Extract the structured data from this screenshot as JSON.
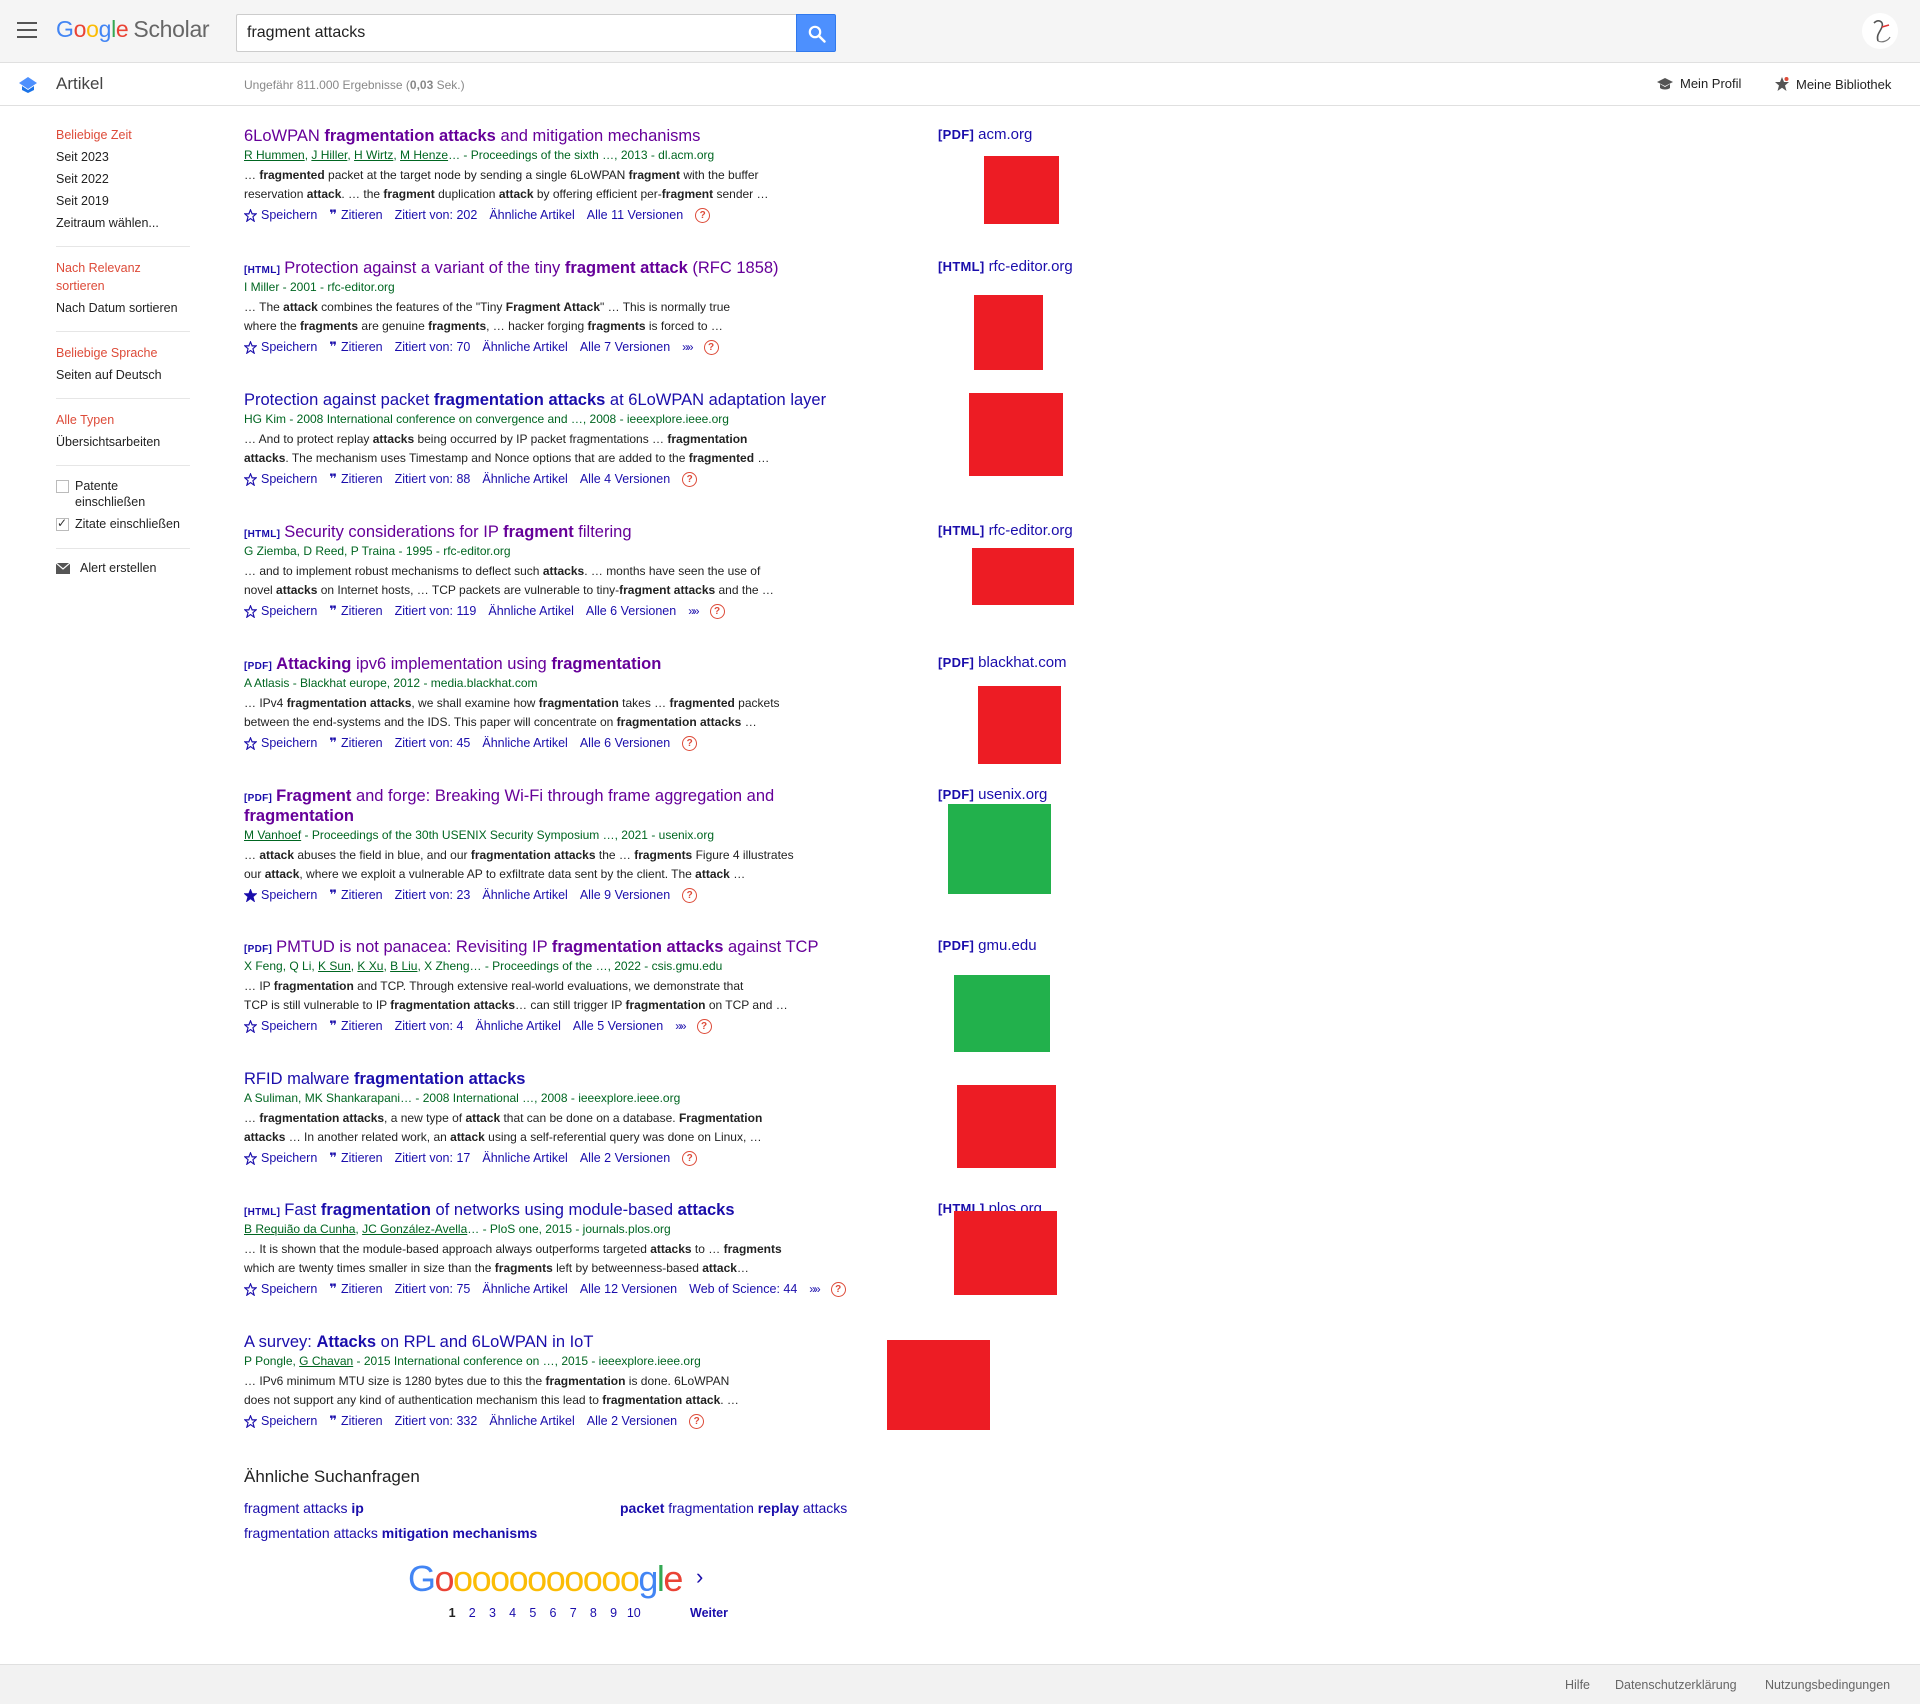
{
  "header": {
    "logo_google": [
      "G",
      "o",
      "o",
      "g",
      "l",
      "e"
    ],
    "logo_scholar": "Scholar",
    "search_value": "fragment attacks"
  },
  "subheader": {
    "section": "Artikel",
    "stats_prefix": "Ungefähr 811.000 Ergebnisse (",
    "stats_time": "0,03",
    "stats_suffix": " Sek.)",
    "profile": "Mein Profil",
    "library": "Meine Bibliothek"
  },
  "sidebar": {
    "time": [
      "Beliebige Zeit",
      "Seit 2023",
      "Seit 2022",
      "Seit 2019",
      "Zeitraum wählen..."
    ],
    "sort": [
      "Nach Relevanz sortieren",
      "Nach Datum sortieren"
    ],
    "language": [
      "Beliebige Sprache",
      "Seiten auf Deutsch"
    ],
    "types": [
      "Alle Typen",
      "Übersichtsarbeiten"
    ],
    "include_patents": "Patente einschließen",
    "include_citations": "Zitate einschließen",
    "create_alert": "Alert erstellen"
  },
  "results": [
    {
      "tag": "",
      "title_html": "6LoWPAN <b>fragmentation attacks</b> and mitigation mechanisms",
      "visited": true,
      "meta_html": "<span class='author-link'>R Hummen</span>, <span class='author-link'>J Hiller</span>, <span class='author-link'>H Wirtz</span>, <span class='author-link'>M Henze</span>… - Proceedings of the sixth …, 2013 - dl.acm.org",
      "snippet_html": "… <b>fragmented</b> packet at the target node by sending a single 6LoWPAN <b>fragment</b> with the buffer<br>reservation <b>attack</b>. … the <b>fragment</b> duplication <b>attack</b> by offering efficient per-<b>fragment</b> sender …",
      "save": "Speichern",
      "cite": "Zitieren",
      "cited_by": "Zitiert von: 202",
      "related": "Ähnliche Artikel",
      "versions": "Alle 11 Versionen",
      "extra": "",
      "more": false,
      "side_tag": "[PDF]",
      "side_domain": "acm.org"
    },
    {
      "tag": "[HTML]",
      "title_html": "Protection against a variant of the tiny <b>fragment attack</b> (RFC 1858)",
      "visited": true,
      "meta_html": "I Miller - 2001 - rfc-editor.org",
      "snippet_html": "… The <b>attack</b> combines the features of the \"Tiny <b>Fragment Attack</b>\" … This is normally true<br>where the <b>fragments</b> are genuine <b>fragments</b>, … hacker forging <b>fragments</b> is forced to …",
      "save": "Speichern",
      "cite": "Zitieren",
      "cited_by": "Zitiert von: 70",
      "related": "Ähnliche Artikel",
      "versions": "Alle 7 Versionen",
      "extra": "",
      "more": true,
      "side_tag": "[HTML]",
      "side_domain": "rfc-editor.org"
    },
    {
      "tag": "",
      "title_html": "Protection against packet <b>fragmentation attacks</b> at 6LoWPAN adaptation layer",
      "visited": false,
      "meta_html": "HG Kim - 2008 International conference on convergence and …, 2008 - ieeexplore.ieee.org",
      "snippet_html": "… And to protect replay <b>attacks</b> being occurred by IP packet fragmentations … <b>fragmentation</b><br><b>attacks</b>. The mechanism uses Timestamp and Nonce options that are added to the <b>fragmented</b> …",
      "save": "Speichern",
      "cite": "Zitieren",
      "cited_by": "Zitiert von: 88",
      "related": "Ähnliche Artikel",
      "versions": "Alle 4 Versionen",
      "extra": "",
      "more": false,
      "side_tag": "",
      "side_domain": ""
    },
    {
      "tag": "[HTML]",
      "title_html": "Security considerations for IP <b>fragment</b> filtering",
      "visited": true,
      "meta_html": "G Ziemba, D Reed, P Traina - 1995 - rfc-editor.org",
      "snippet_html": "… and to implement robust mechanisms to deflect such <b>attacks</b>. … months have seen the use of<br>novel <b>attacks</b> on Internet hosts, … TCP packets are vulnerable to tiny-<b>fragment attacks</b> and the …",
      "save": "Speichern",
      "cite": "Zitieren",
      "cited_by": "Zitiert von: 119",
      "related": "Ähnliche Artikel",
      "versions": "Alle 6 Versionen",
      "extra": "",
      "more": true,
      "side_tag": "[HTML]",
      "side_domain": "rfc-editor.org"
    },
    {
      "tag": "[PDF]",
      "title_html": "<b>Attacking</b> ipv6 implementation using <b>fragmentation</b>",
      "visited": true,
      "meta_html": "A Atlasis - Blackhat europe, 2012 - media.blackhat.com",
      "snippet_html": "… IPv4 <b>fragmentation attacks</b>, we shall examine how <b>fragmentation</b> takes … <b>fragmented</b> packets<br>between the end-systems and the IDS. This paper will concentrate on <b>fragmentation attacks</b> …",
      "save": "Speichern",
      "cite": "Zitieren",
      "cited_by": "Zitiert von: 45",
      "related": "Ähnliche Artikel",
      "versions": "Alle 6 Versionen",
      "extra": "",
      "more": false,
      "side_tag": "[PDF]",
      "side_domain": "blackhat.com"
    },
    {
      "tag": "[PDF]",
      "title_html": "<b>Fragment</b> and forge: Breaking Wi-Fi through frame aggregation and<br><b>fragmentation</b>",
      "visited": true,
      "meta_html": "<span class='author-link'>M Vanhoef</span> - Proceedings of the 30th USENIX Security Symposium …, 2021 - usenix.org",
      "snippet_html": "… <b>attack</b> abuses the field in blue, and our <b>fragmentation attacks</b> the … <b>fragments</b> Figure 4 illustrates<br>our <b>attack</b>, where we exploit a vulnerable AP to exfiltrate data sent by the client. The <b>attack</b> …",
      "save": "Speichern",
      "cite": "Zitieren",
      "cited_by": "Zitiert von: 23",
      "related": "Ähnliche Artikel",
      "versions": "Alle 9 Versionen",
      "extra": "",
      "more": false,
      "saved": true,
      "side_tag": "[PDF]",
      "side_domain": "usenix.org"
    },
    {
      "tag": "[PDF]",
      "title_html": "PMTUD is not panacea: Revisiting IP <b>fragmentation attacks</b> against TCP",
      "visited": true,
      "meta_html": "X Feng, Q Li, <span class='author-link'>K Sun</span>, <span class='author-link'>K Xu</span>, <span class='author-link'>B Liu</span>, X Zheng… - Proceedings of the …, 2022 - csis.gmu.edu",
      "snippet_html": "… IP <b>fragmentation</b> and TCP. Through extensive real-world evaluations, we demonstrate that<br>TCP is still vulnerable to IP <b>fragmentation attacks</b>… can still trigger IP <b>fragmentation</b> on TCP and …",
      "save": "Speichern",
      "cite": "Zitieren",
      "cited_by": "Zitiert von: 4",
      "related": "Ähnliche Artikel",
      "versions": "Alle 5 Versionen",
      "extra": "",
      "more": true,
      "side_tag": "[PDF]",
      "side_domain": "gmu.edu"
    },
    {
      "tag": "",
      "title_html": "RFID malware <b>fragmentation attacks</b>",
      "visited": false,
      "meta_html": "A Suliman, MK Shankarapani… - 2008 International …, 2008 - ieeexplore.ieee.org",
      "snippet_html": "… <b>fragmentation attacks</b>, a new type of <b>attack</b> that can be done on a database. <b>Fragmentation</b><br><b>attacks</b> … In another related work, an <b>attack</b> using a self-referential query was done on Linux, …",
      "save": "Speichern",
      "cite": "Zitieren",
      "cited_by": "Zitiert von: 17",
      "related": "Ähnliche Artikel",
      "versions": "Alle 2 Versionen",
      "extra": "",
      "more": false,
      "side_tag": "",
      "side_domain": ""
    },
    {
      "tag": "[HTML]",
      "title_html": "Fast <b>fragmentation</b> of networks using module-based <b>attacks</b>",
      "visited": false,
      "meta_html": "<span class='author-link'>B Requião da Cunha</span>, <span class='author-link'>JC González-Avella</span>… - PloS one, 2015 - journals.plos.org",
      "snippet_html": "… It is shown that the module-based approach always outperforms targeted <b>attacks</b> to … <b>fragments</b><br>which are twenty times smaller in size than the <b>fragments</b> left by betweenness-based <b>attack</b>…",
      "save": "Speichern",
      "cite": "Zitieren",
      "cited_by": "Zitiert von: 75",
      "related": "Ähnliche Artikel",
      "versions": "Alle 12 Versionen",
      "extra": "Web of Science: 44",
      "more": true,
      "side_tag": "[HTML]",
      "side_domain": "plos.org"
    },
    {
      "tag": "",
      "title_html": "A survey: <b>Attacks</b> on RPL and 6LoWPAN in IoT",
      "visited": false,
      "meta_html": "P Pongle, <span class='author-link'>G Chavan</span> - 2015 International conference on …, 2015 - ieeexplore.ieee.org",
      "snippet_html": "… IPv6 minimum MTU size is 1280 bytes due to this the <b>fragmentation</b> is done. 6LoWPAN<br>does not support any kind of authentication mechanism this lead to <b>fragmentation attack</b>. …",
      "save": "Speichern",
      "cite": "Zitieren",
      "cited_by": "Zitiert von: 332",
      "related": "Ähnliche Artikel",
      "versions": "Alle 2 Versionen",
      "extra": "",
      "more": false,
      "side_tag": "",
      "side_domain": ""
    }
  ],
  "related_searches": {
    "title": "Ähnliche Suchanfragen",
    "items_html": [
      "fragment attacks <b>ip</b>",
      "<b>packet</b> fragmentation <b>replay</b> attacks",
      "fragmentation attacks <b>mitigation mechanisms</b>"
    ]
  },
  "pagination": {
    "logo": [
      "G",
      "o",
      "o",
      "o",
      "o",
      "o",
      "o",
      "o",
      "o",
      "o",
      "o",
      "o",
      "g",
      "l",
      "e"
    ],
    "pages": [
      "1",
      "2",
      "3",
      "4",
      "5",
      "6",
      "7",
      "8",
      "9",
      "10"
    ],
    "current": "1",
    "next": "Weiter"
  },
  "footer": {
    "help": "Hilfe",
    "privacy": "Datenschutzerklärung",
    "terms": "Nutzungsbedingungen"
  },
  "colors": {
    "thumb_red": "#ed1c24",
    "thumb_green": "#22b14c",
    "link": "#1a0dab",
    "visited": "#660099",
    "meta_green": "#006621",
    "accent_red": "#dd4b39"
  }
}
